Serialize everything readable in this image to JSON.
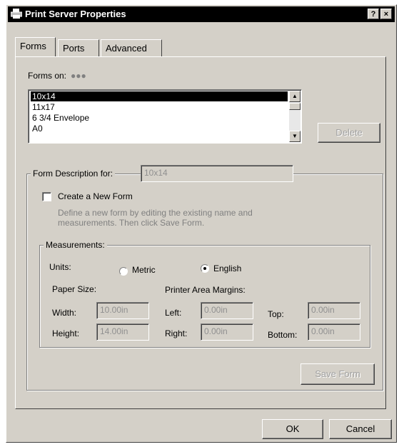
{
  "window": {
    "title": "Print Server Properties",
    "help_label": "?",
    "close_label": "×"
  },
  "tabs": [
    {
      "label": "Forms"
    },
    {
      "label": "Ports"
    },
    {
      "label": "Advanced"
    }
  ],
  "forms": {
    "forms_on_label": "Forms on:",
    "forms_on_value": "●●●",
    "items": [
      "10x14",
      "11x17",
      "6 3/4 Envelope",
      "A0"
    ],
    "selected": "10x14",
    "delete_label": "Delete"
  },
  "description": {
    "label": "Form Description for:",
    "value": "10x14",
    "create_label": "Create a New Form",
    "hint_line1": "Define a new form by editing the existing name and",
    "hint_line2": "measurements.  Then click Save Form."
  },
  "measurements": {
    "title": "Measurements:",
    "units_label": "Units:",
    "metric_label": "Metric",
    "english_label": "English",
    "selected_unit": "English",
    "paper_size_label": "Paper Size:",
    "margins_label": "Printer Area Margins:",
    "width_label": "Width:",
    "width_value": "10.00in",
    "height_label": "Height:",
    "height_value": "14.00in",
    "left_label": "Left:",
    "left_value": "0.00in",
    "right_label": "Right:",
    "right_value": "0.00in",
    "top_label": "Top:",
    "top_value": "0.00in",
    "bottom_label": "Bottom:",
    "bottom_value": "0.00in",
    "save_label": "Save Form"
  },
  "footer": {
    "ok_label": "OK",
    "cancel_label": "Cancel"
  }
}
